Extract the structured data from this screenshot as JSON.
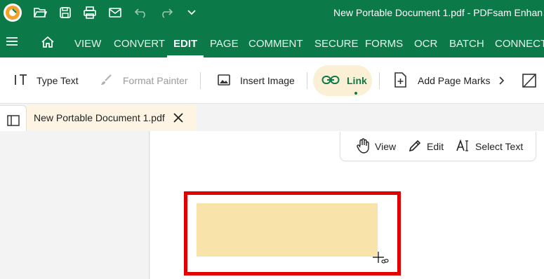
{
  "title_bar": {
    "document_title": "New Portable Document 1.pdf  -  PDFsam Enhan",
    "background": "#0b7a48",
    "quick_access_icons": [
      "app-logo-icon",
      "open-folder-icon",
      "save-icon",
      "print-icon",
      "email-icon",
      "undo-icon",
      "redo-icon",
      "chevron-down-icon"
    ]
  },
  "menu": {
    "items": [
      "VIEW",
      "CONVERT",
      "EDIT",
      "PAGE",
      "COMMENT",
      "SECURE",
      "FORMS",
      "OCR",
      "BATCH",
      "CONNECT"
    ],
    "active": "EDIT"
  },
  "toolbar": {
    "type_text": "Type Text",
    "format_painter": "Format Painter",
    "insert_image": "Insert Image",
    "link": "Link",
    "add_page_marks": "Add Page Marks"
  },
  "tab": {
    "name": "New Portable Document 1.pdf"
  },
  "view_tools": {
    "view": "View",
    "edit": "Edit",
    "select_text": "Select Text"
  },
  "colors": {
    "brand": "#0b7a48",
    "link_area_fill": "#f8e3aa",
    "highlight_outline": "#e10000",
    "tab_background": "#fdf4e3"
  }
}
